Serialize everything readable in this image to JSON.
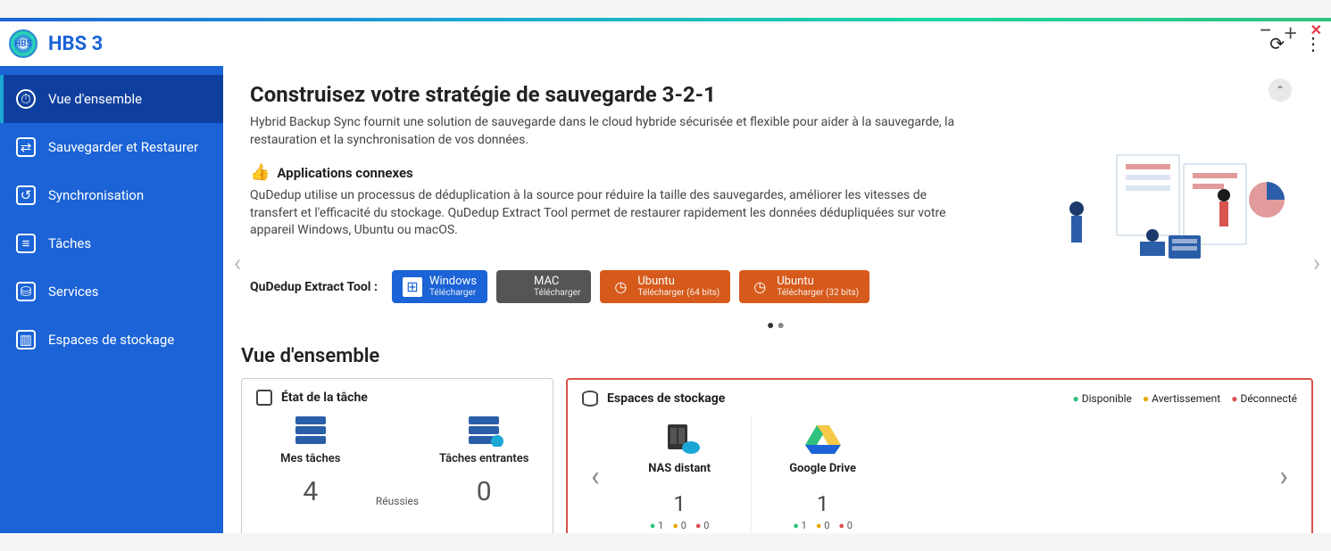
{
  "app": {
    "title": "HBS 3"
  },
  "sidebar": {
    "items": [
      {
        "label": "Vue d'ensemble"
      },
      {
        "label": "Sauvegarder et Restaurer"
      },
      {
        "label": "Synchronisation"
      },
      {
        "label": "Tâches"
      },
      {
        "label": "Services"
      },
      {
        "label": "Espaces de stockage"
      }
    ]
  },
  "hero": {
    "title": "Construisez votre stratégie de sauvegarde 3-2-1",
    "subtitle": "Hybrid Backup Sync fournit une solution de sauvegarde dans le cloud hybride sécurisée et flexible pour aider à la sauvegarde, la restauration et la synchronisation de vos données.",
    "related_title": "Applications connexes",
    "related_text": "QuDedup utilise un processus de déduplication à la source pour réduire la taille des sauvegardes, améliorer les vitesses de transfert et l'efficacité du stockage. QuDedup Extract Tool permet de restaurer rapidement les données dédupliquées sur votre appareil Windows, Ubuntu ou macOS."
  },
  "tool": {
    "label": "QuDedup Extract Tool :",
    "buttons": [
      {
        "os": "Windows",
        "sub": "Télécharger"
      },
      {
        "os": "MAC",
        "sub": "Télécharger"
      },
      {
        "os": "Ubuntu",
        "sub": "Télécharger (64 bits)"
      },
      {
        "os": "Ubuntu",
        "sub": "Télécharger (32 bits)"
      }
    ]
  },
  "overview": {
    "title": "Vue d'ensemble",
    "task_state": {
      "title": "État de la tâche",
      "my_tasks_label": "Mes tâches",
      "my_tasks_count": "4",
      "incoming_label": "Tâches entrantes",
      "incoming_count": "0",
      "success_label": "Réussies"
    },
    "storage": {
      "title": "Espaces de stockage",
      "legend": {
        "available": "Disponible",
        "warning": "Avertissement",
        "disconnected": "Déconnecté"
      },
      "items": [
        {
          "name": "NAS distant",
          "count": "1",
          "g": "1",
          "o": "0",
          "r": "0"
        },
        {
          "name": "Google Drive",
          "count": "1",
          "g": "1",
          "o": "0",
          "r": "0"
        }
      ]
    }
  }
}
